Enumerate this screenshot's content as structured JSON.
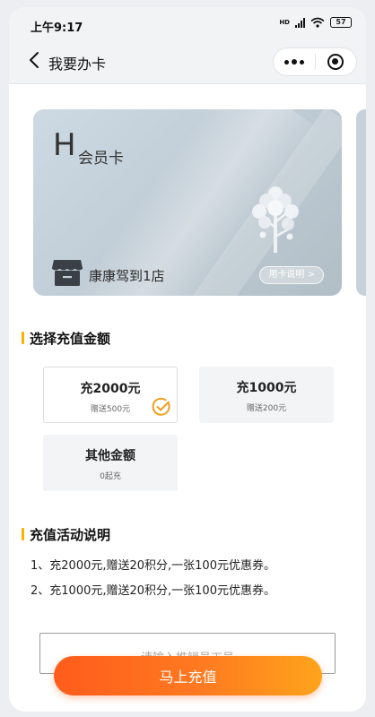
{
  "status_bar": {
    "time": "上午9:17",
    "network": "HD",
    "battery": "57"
  },
  "nav": {
    "title": "我要办卡"
  },
  "card": {
    "letter": "H",
    "type": "会员卡",
    "store": "康康驾到1店",
    "help": "用卡说明 >"
  },
  "amount_section": {
    "title": "选择充值金额"
  },
  "options": [
    {
      "title": "充2000元",
      "sub": "赠送500元",
      "selected": true
    },
    {
      "title": "充1000元",
      "sub": "赠送200元",
      "selected": false
    },
    {
      "title": "其他金额",
      "sub": "0起充",
      "selected": false
    }
  ],
  "desc_section": {
    "title": "充值活动说明",
    "lines": [
      "1、充2000元,赠送20积分,一张100元优惠券。",
      "2、充1000元,赠送20积分,一张100元优惠券。"
    ]
  },
  "staff": {
    "placeholder": "请输入推销员工号"
  },
  "recharge_button": {
    "label": "马上充值"
  },
  "colors": {
    "accent": "#f5b400",
    "button_start": "#ff5c1c",
    "button_end": "#ffa41b",
    "check": "#f0a020"
  }
}
